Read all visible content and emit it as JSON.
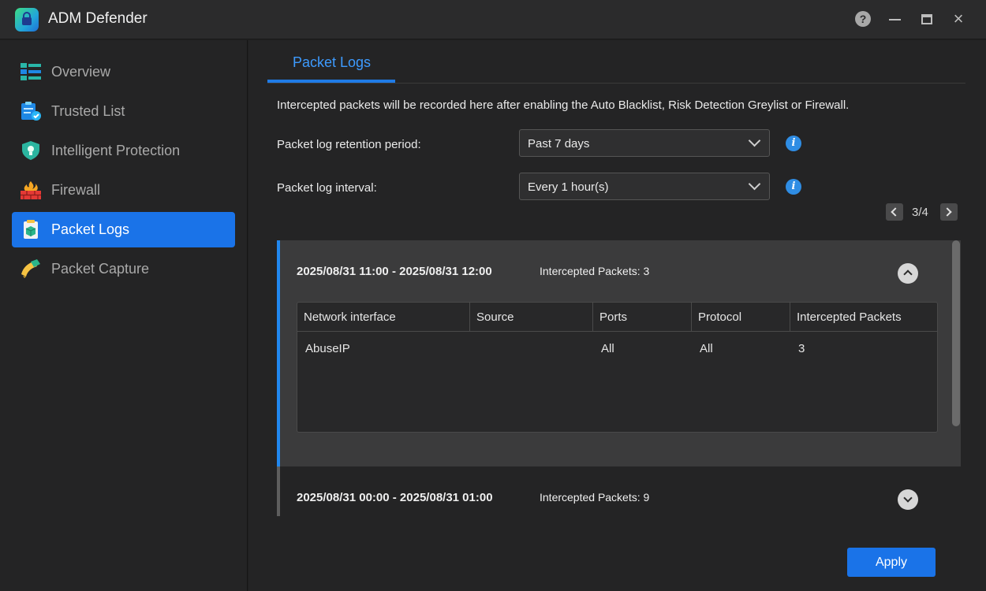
{
  "window": {
    "title": "ADM Defender",
    "controls": [
      "help-icon",
      "minimize-icon",
      "maximize-icon",
      "close-icon"
    ]
  },
  "sidebar": {
    "items": [
      {
        "label": "Overview",
        "icon": "overview-icon",
        "active": false
      },
      {
        "label": "Trusted List",
        "icon": "trusted-list-icon",
        "active": false
      },
      {
        "label": "Intelligent Protection",
        "icon": "shield-icon",
        "active": false
      },
      {
        "label": "Firewall",
        "icon": "firewall-icon",
        "active": false
      },
      {
        "label": "Packet Logs",
        "icon": "packet-logs-icon",
        "active": true
      },
      {
        "label": "Packet Capture",
        "icon": "packet-capture-icon",
        "active": false
      }
    ]
  },
  "main": {
    "tab": "Packet Logs",
    "description": "Intercepted packets will be recorded here after enabling the Auto Blacklist, Risk Detection Greylist or Firewall.",
    "retention": {
      "label": "Packet log retention period:",
      "value": "Past 7 days"
    },
    "interval": {
      "label": "Packet log interval:",
      "value": "Every 1 hour(s)"
    },
    "pager": {
      "text": "3/4",
      "current": 3,
      "total": 4
    },
    "groups": [
      {
        "range": "2025/08/31 11:00 - 2025/08/31 12:00",
        "count_label": "Intercepted Packets: 3",
        "expanded": true,
        "columns": [
          "Network interface",
          "Source",
          "Ports",
          "Protocol",
          "Intercepted Packets"
        ],
        "rows": [
          {
            "interface": "AbuseIP",
            "source": "",
            "ports": "All",
            "protocol": "All",
            "packets": "3"
          }
        ]
      },
      {
        "range": "2025/08/31 00:00 - 2025/08/31 01:00",
        "count_label": "Intercepted Packets: 9",
        "expanded": false
      }
    ],
    "apply_label": "Apply"
  },
  "colors": {
    "accent": "#1a73e8",
    "tab_text": "#3d9bff",
    "info": "#2f8de4",
    "background": "#242425"
  }
}
